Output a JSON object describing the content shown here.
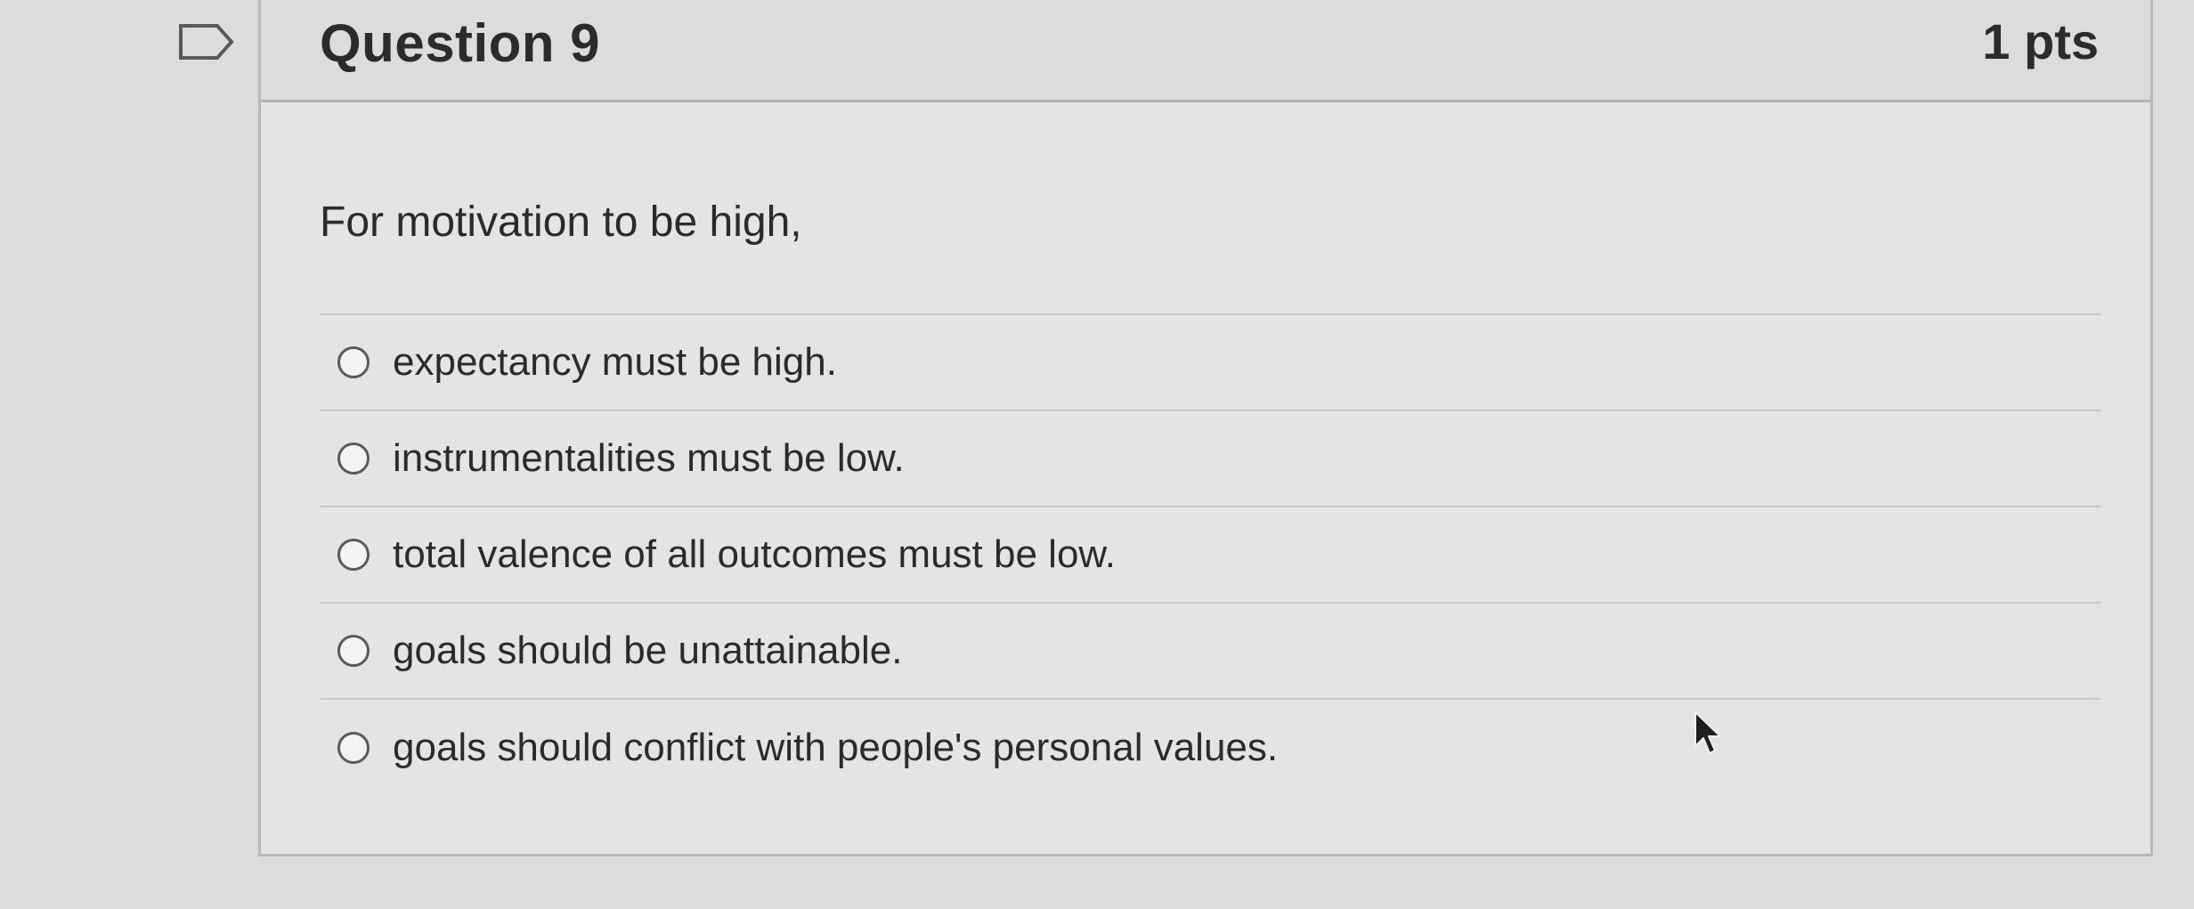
{
  "question": {
    "title": "Question 9",
    "points": "1 pts",
    "text": "For motivation to be high,",
    "answers": [
      {
        "label": "expectancy must be high.",
        "selected": false
      },
      {
        "label": "instrumentalities must be low.",
        "selected": false
      },
      {
        "label": "total valence of all outcomes must be low.",
        "selected": false
      },
      {
        "label": "goals should be unattainable.",
        "selected": false
      },
      {
        "label": "goals should conflict with people's personal values.",
        "selected": false
      }
    ]
  },
  "icons": {
    "flag": "flag-icon",
    "radio": "radio-button",
    "cursor": "mouse-pointer-icon"
  },
  "colors": {
    "page_background": "#dcdcda",
    "card_background": "#e4e4e2",
    "text": "#2b2b2b",
    "border": "#b8b8b6"
  }
}
